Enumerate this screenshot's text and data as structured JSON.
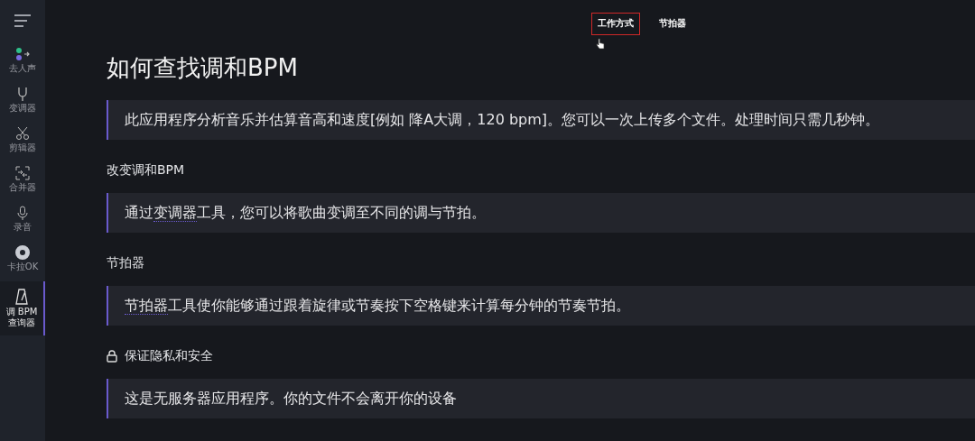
{
  "sidebar": {
    "items": [
      {
        "label": "去人声",
        "kind": "dots",
        "selected": false
      },
      {
        "label": "变调器",
        "kind": "fork",
        "selected": false
      },
      {
        "label": "剪辑器",
        "kind": "scissors",
        "selected": false
      },
      {
        "label": "合并器",
        "kind": "merge",
        "selected": false
      },
      {
        "label": "录音",
        "kind": "mic",
        "selected": false
      },
      {
        "label": "卡拉OK",
        "kind": "disc",
        "selected": false
      },
      {
        "label": "调 BPM 查询器",
        "kind": "metronome",
        "selected": true
      }
    ]
  },
  "top_nav": [
    {
      "label": "工作方式",
      "selected": true
    },
    {
      "label": "节拍器",
      "selected": false
    }
  ],
  "title": "如何查找调和BPM",
  "sections": [
    {
      "text": [
        {
          "t": "此应用程序分析音乐并估算音高和速度[例如 降A大调，120 bpm]。您可以一次上传多个文件。处理时间只需几秒钟。"
        }
      ]
    },
    {
      "heading": "改变调和BPM",
      "text": [
        {
          "t": "通过"
        },
        {
          "t": "变调器",
          "link": true
        },
        {
          "t": "工具，您可以将歌曲变调至不同的调与节拍。"
        }
      ]
    },
    {
      "heading": "节拍器",
      "text": [
        {
          "t": "节拍器",
          "link": true
        },
        {
          "t": "工具使你能够通过跟着旋律或节奏按下空格键来计算每分钟的节奏节拍。"
        }
      ]
    },
    {
      "heading": "保证隐私和安全",
      "kind": "lock",
      "text": [
        {
          "t": "这是无服务器应用程序。你的文件不会离开你的设备"
        }
      ]
    }
  ]
}
